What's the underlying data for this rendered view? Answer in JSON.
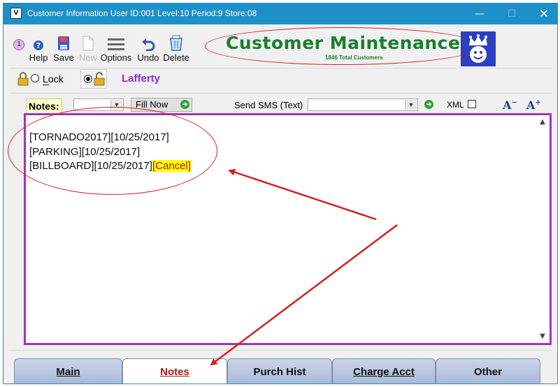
{
  "window": {
    "title": "Customer Information   User ID:001 Level:10 Period:9 Store:08",
    "icon": "app-icon",
    "controls": {
      "minimize": "—",
      "maximize": "☐",
      "close": "✕"
    }
  },
  "toolbar": {
    "badge": "1",
    "items": [
      {
        "label": "Help",
        "icon": "help-icon",
        "enabled": true
      },
      {
        "label": "Save",
        "icon": "save-icon",
        "enabled": true
      },
      {
        "label": "New",
        "icon": "new-document-icon",
        "enabled": false
      },
      {
        "label": "Options",
        "icon": "options-icon",
        "enabled": true
      },
      {
        "label": "Undo",
        "icon": "undo-icon",
        "enabled": true
      },
      {
        "label": "Delete",
        "icon": "delete-icon",
        "enabled": true
      }
    ]
  },
  "header": {
    "title": "Customer Maintenance",
    "subtitle": "1846 Total Customers",
    "logo": "crown-smiley-logo"
  },
  "lock_row": {
    "lock_label": "Lock",
    "customer_name": "Lafferty"
  },
  "notes_bar": {
    "notes_label": "Notes:",
    "notes_select_value": "",
    "fill_now_label": "Fill Now",
    "send_sms_label": "Send SMS (Text)",
    "sms_select_value": "",
    "xml_label": "XML",
    "xml_checked": false,
    "font_decrease": "A",
    "font_increase": "A"
  },
  "editor": {
    "lines": [
      {
        "text": "[TORNADO2017][10/25/2017]",
        "highlight": ""
      },
      {
        "text": "[PARKING][10/25/2017]",
        "highlight": ""
      },
      {
        "text": "[BILLBOARD][10/25/2017]",
        "highlight": "[Cancel]"
      }
    ]
  },
  "tabs": [
    {
      "label": "Main",
      "active": false
    },
    {
      "label": "Notes",
      "active": true
    },
    {
      "label": "Purch Hist",
      "active": false
    },
    {
      "label": "Charge Acct",
      "active": false
    },
    {
      "label": "Other",
      "active": false
    }
  ],
  "colors": {
    "titlebar": "#1e90c8",
    "header_green": "#1a7f2e",
    "annotation_red": "#d61f1f",
    "editor_border": "#a335b8",
    "customer_name": "#8a2be2",
    "highlight": "#ffff00"
  }
}
